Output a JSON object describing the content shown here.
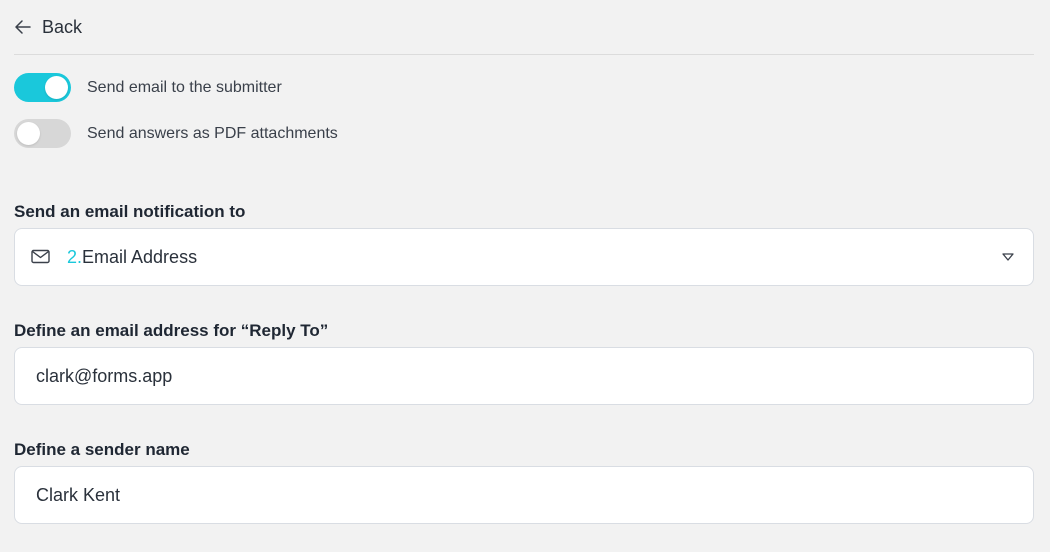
{
  "header": {
    "back_label": "Back",
    "back_icon": "arrow-left-icon"
  },
  "toggles": [
    {
      "label": "Send email to the submitter",
      "on": true
    },
    {
      "label": "Send answers as PDF attachments",
      "on": false
    }
  ],
  "notification": {
    "label": "Send an email notification to",
    "icon": "mail-icon",
    "selected_number": "2.",
    "selected_text": "Email Address",
    "dropdown_icon": "chevron-down-icon"
  },
  "reply_to": {
    "label": "Define an email address for “Reply To”",
    "value": "clark@forms.app"
  },
  "sender": {
    "label": "Define a sender name",
    "value": "Clark Kent"
  },
  "colors": {
    "accent": "#1ac8db",
    "toggle_off": "#d7d7d7",
    "background": "#f2f2f2"
  }
}
